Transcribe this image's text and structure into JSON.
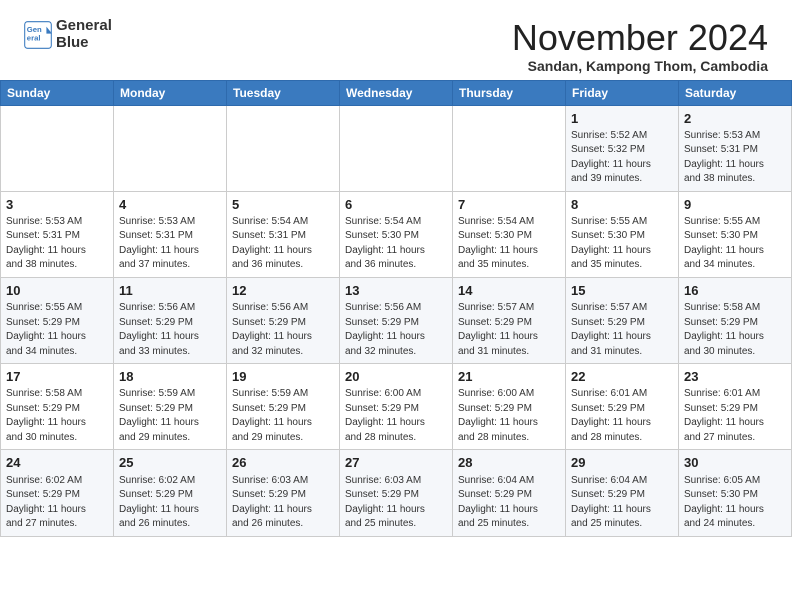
{
  "header": {
    "logo_line1": "General",
    "logo_line2": "Blue",
    "month": "November 2024",
    "location": "Sandan, Kampong Thom, Cambodia"
  },
  "weekdays": [
    "Sunday",
    "Monday",
    "Tuesday",
    "Wednesday",
    "Thursday",
    "Friday",
    "Saturday"
  ],
  "weeks": [
    [
      {
        "day": "",
        "info": ""
      },
      {
        "day": "",
        "info": ""
      },
      {
        "day": "",
        "info": ""
      },
      {
        "day": "",
        "info": ""
      },
      {
        "day": "",
        "info": ""
      },
      {
        "day": "1",
        "info": "Sunrise: 5:52 AM\nSunset: 5:32 PM\nDaylight: 11 hours\nand 39 minutes."
      },
      {
        "day": "2",
        "info": "Sunrise: 5:53 AM\nSunset: 5:31 PM\nDaylight: 11 hours\nand 38 minutes."
      }
    ],
    [
      {
        "day": "3",
        "info": "Sunrise: 5:53 AM\nSunset: 5:31 PM\nDaylight: 11 hours\nand 38 minutes."
      },
      {
        "day": "4",
        "info": "Sunrise: 5:53 AM\nSunset: 5:31 PM\nDaylight: 11 hours\nand 37 minutes."
      },
      {
        "day": "5",
        "info": "Sunrise: 5:54 AM\nSunset: 5:31 PM\nDaylight: 11 hours\nand 36 minutes."
      },
      {
        "day": "6",
        "info": "Sunrise: 5:54 AM\nSunset: 5:30 PM\nDaylight: 11 hours\nand 36 minutes."
      },
      {
        "day": "7",
        "info": "Sunrise: 5:54 AM\nSunset: 5:30 PM\nDaylight: 11 hours\nand 35 minutes."
      },
      {
        "day": "8",
        "info": "Sunrise: 5:55 AM\nSunset: 5:30 PM\nDaylight: 11 hours\nand 35 minutes."
      },
      {
        "day": "9",
        "info": "Sunrise: 5:55 AM\nSunset: 5:30 PM\nDaylight: 11 hours\nand 34 minutes."
      }
    ],
    [
      {
        "day": "10",
        "info": "Sunrise: 5:55 AM\nSunset: 5:29 PM\nDaylight: 11 hours\nand 34 minutes."
      },
      {
        "day": "11",
        "info": "Sunrise: 5:56 AM\nSunset: 5:29 PM\nDaylight: 11 hours\nand 33 minutes."
      },
      {
        "day": "12",
        "info": "Sunrise: 5:56 AM\nSunset: 5:29 PM\nDaylight: 11 hours\nand 32 minutes."
      },
      {
        "day": "13",
        "info": "Sunrise: 5:56 AM\nSunset: 5:29 PM\nDaylight: 11 hours\nand 32 minutes."
      },
      {
        "day": "14",
        "info": "Sunrise: 5:57 AM\nSunset: 5:29 PM\nDaylight: 11 hours\nand 31 minutes."
      },
      {
        "day": "15",
        "info": "Sunrise: 5:57 AM\nSunset: 5:29 PM\nDaylight: 11 hours\nand 31 minutes."
      },
      {
        "day": "16",
        "info": "Sunrise: 5:58 AM\nSunset: 5:29 PM\nDaylight: 11 hours\nand 30 minutes."
      }
    ],
    [
      {
        "day": "17",
        "info": "Sunrise: 5:58 AM\nSunset: 5:29 PM\nDaylight: 11 hours\nand 30 minutes."
      },
      {
        "day": "18",
        "info": "Sunrise: 5:59 AM\nSunset: 5:29 PM\nDaylight: 11 hours\nand 29 minutes."
      },
      {
        "day": "19",
        "info": "Sunrise: 5:59 AM\nSunset: 5:29 PM\nDaylight: 11 hours\nand 29 minutes."
      },
      {
        "day": "20",
        "info": "Sunrise: 6:00 AM\nSunset: 5:29 PM\nDaylight: 11 hours\nand 28 minutes."
      },
      {
        "day": "21",
        "info": "Sunrise: 6:00 AM\nSunset: 5:29 PM\nDaylight: 11 hours\nand 28 minutes."
      },
      {
        "day": "22",
        "info": "Sunrise: 6:01 AM\nSunset: 5:29 PM\nDaylight: 11 hours\nand 28 minutes."
      },
      {
        "day": "23",
        "info": "Sunrise: 6:01 AM\nSunset: 5:29 PM\nDaylight: 11 hours\nand 27 minutes."
      }
    ],
    [
      {
        "day": "24",
        "info": "Sunrise: 6:02 AM\nSunset: 5:29 PM\nDaylight: 11 hours\nand 27 minutes."
      },
      {
        "day": "25",
        "info": "Sunrise: 6:02 AM\nSunset: 5:29 PM\nDaylight: 11 hours\nand 26 minutes."
      },
      {
        "day": "26",
        "info": "Sunrise: 6:03 AM\nSunset: 5:29 PM\nDaylight: 11 hours\nand 26 minutes."
      },
      {
        "day": "27",
        "info": "Sunrise: 6:03 AM\nSunset: 5:29 PM\nDaylight: 11 hours\nand 25 minutes."
      },
      {
        "day": "28",
        "info": "Sunrise: 6:04 AM\nSunset: 5:29 PM\nDaylight: 11 hours\nand 25 minutes."
      },
      {
        "day": "29",
        "info": "Sunrise: 6:04 AM\nSunset: 5:29 PM\nDaylight: 11 hours\nand 25 minutes."
      },
      {
        "day": "30",
        "info": "Sunrise: 6:05 AM\nSunset: 5:30 PM\nDaylight: 11 hours\nand 24 minutes."
      }
    ]
  ]
}
